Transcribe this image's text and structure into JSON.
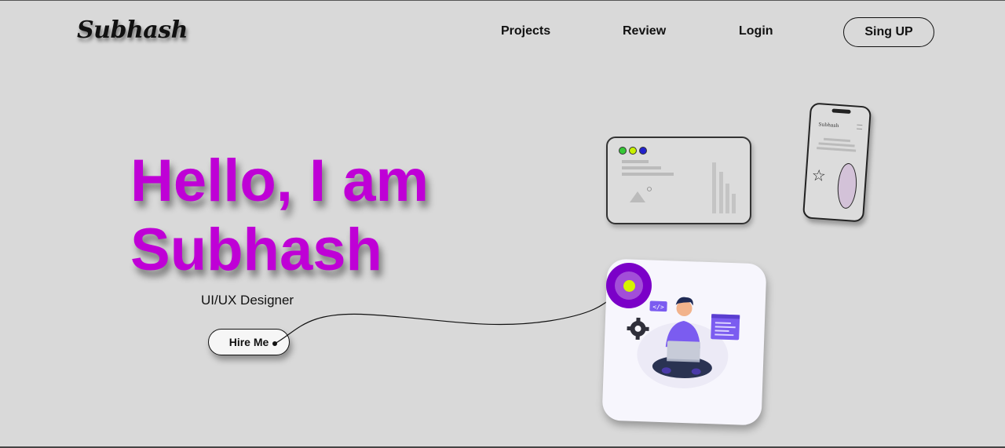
{
  "header": {
    "logo": "Subhash",
    "nav": [
      {
        "label": "Projects"
      },
      {
        "label": "Review"
      },
      {
        "label": "Login"
      }
    ],
    "signup_label": "Sing UP"
  },
  "hero": {
    "title_line1": "Hello, I am",
    "title_line2": "Subhash",
    "subtitle": "UI/UX Designer",
    "cta_label": "Hire Me"
  },
  "mockups": {
    "phone_brand": "Subhash",
    "window_dot_colors": [
      "#37c837",
      "#c8f000",
      "#2222cc"
    ]
  },
  "colors": {
    "background": "#d9d9d9",
    "accent": "#bf00d6",
    "target": "#7b00c8",
    "illustration_purple": "#7b5cf0"
  }
}
